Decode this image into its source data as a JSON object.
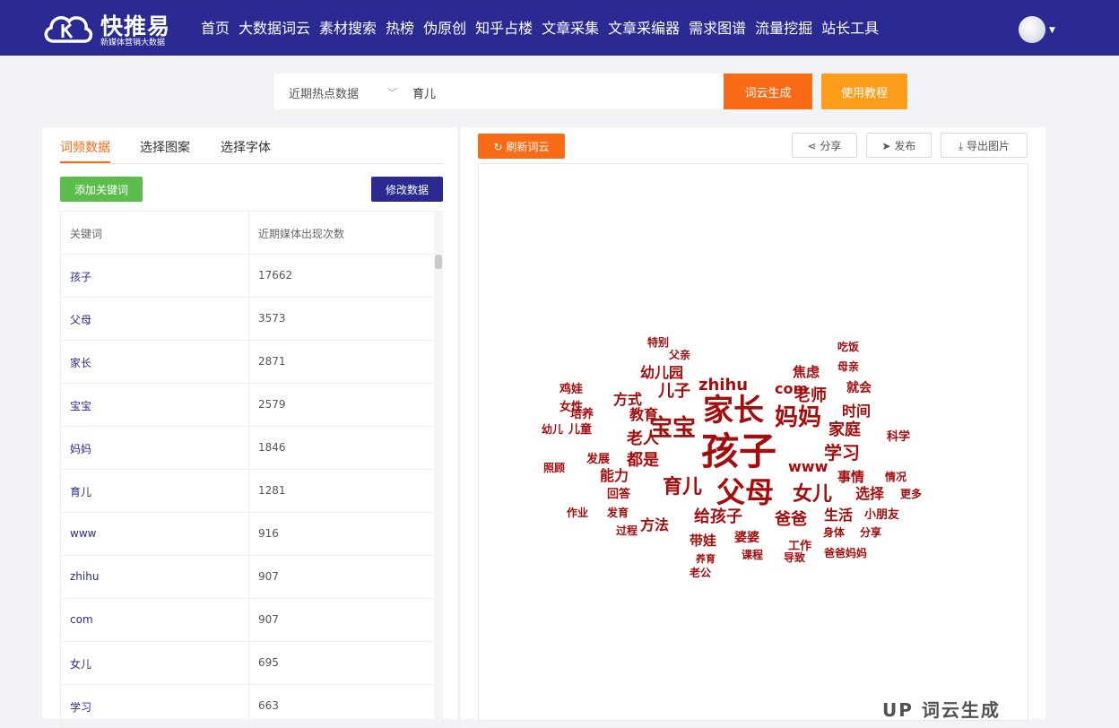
{
  "brand": {
    "name": "快推易",
    "tagline": "新媒体营销大数据"
  },
  "nav": [
    "首页",
    "大数据词云",
    "素材搜索",
    "热榜",
    "伪原创",
    "知乎占楼",
    "文章采集",
    "文章采编器",
    "需求图谱",
    "流量挖掘",
    "站长工具"
  ],
  "search": {
    "source_select": "近期热点数据",
    "query": "育儿",
    "generate_label": "词云生成",
    "tutorial_label": "使用教程"
  },
  "left_tabs": [
    "词频数据",
    "选择图案",
    "选择字体"
  ],
  "left_buttons": {
    "add": "添加关键词",
    "edit": "修改数据"
  },
  "table": {
    "headers": [
      "关键词",
      "近期媒体出现次数"
    ],
    "rows": [
      [
        "孩子",
        "17662"
      ],
      [
        "父母",
        "3573"
      ],
      [
        "家长",
        "2871"
      ],
      [
        "宝宝",
        "2579"
      ],
      [
        "妈妈",
        "1846"
      ],
      [
        "育儿",
        "1281"
      ],
      [
        "www",
        "916"
      ],
      [
        "zhihu",
        "907"
      ],
      [
        "com",
        "907"
      ],
      [
        "女儿",
        "695"
      ],
      [
        "学习",
        "663"
      ]
    ]
  },
  "toolbar": {
    "refresh": "刷新词云",
    "share": "分享",
    "publish": "发布",
    "export": "导出图片"
  },
  "cloud": {
    "color": "#a50d0d",
    "words": [
      {
        "t": "孩子",
        "s": 42
      },
      {
        "t": "家长",
        "s": 34
      },
      {
        "t": "父母",
        "s": 32
      },
      {
        "t": "宝宝",
        "s": 26
      },
      {
        "t": "妈妈",
        "s": 26
      },
      {
        "t": "育儿",
        "s": 22
      },
      {
        "t": "www",
        "s": 16
      },
      {
        "t": "zhihu",
        "s": 18
      },
      {
        "t": "com",
        "s": 16
      },
      {
        "t": "女儿",
        "s": 22
      },
      {
        "t": "学习",
        "s": 20
      },
      {
        "t": "老师",
        "s": 18
      },
      {
        "t": "家庭",
        "s": 18
      },
      {
        "t": "儿子",
        "s": 18
      },
      {
        "t": "教育",
        "s": 16
      },
      {
        "t": "老人",
        "s": 18
      },
      {
        "t": "都是",
        "s": 18
      },
      {
        "t": "时间",
        "s": 16
      },
      {
        "t": "给孩子",
        "s": 18
      },
      {
        "t": "爸爸",
        "s": 18
      },
      {
        "t": "生活",
        "s": 16
      },
      {
        "t": "选择",
        "s": 16
      },
      {
        "t": "方式",
        "s": 16
      },
      {
        "t": "能力",
        "s": 16
      },
      {
        "t": "幼儿园",
        "s": 16
      },
      {
        "t": "焦虑",
        "s": 15
      },
      {
        "t": "就会",
        "s": 14
      },
      {
        "t": "事情",
        "s": 15
      },
      {
        "t": "科学",
        "s": 13
      },
      {
        "t": "方法",
        "s": 16
      },
      {
        "t": "带娃",
        "s": 15
      },
      {
        "t": "婆婆",
        "s": 14
      },
      {
        "t": "小朋友",
        "s": 13
      },
      {
        "t": "身体",
        "s": 12
      },
      {
        "t": "分享",
        "s": 12
      },
      {
        "t": "工作",
        "s": 13
      },
      {
        "t": "课程",
        "s": 12
      },
      {
        "t": "导致",
        "s": 12
      },
      {
        "t": "爸爸妈妈",
        "s": 12
      },
      {
        "t": "情况",
        "s": 12
      },
      {
        "t": "更多",
        "s": 12
      },
      {
        "t": "发展",
        "s": 13
      },
      {
        "t": "回答",
        "s": 13
      },
      {
        "t": "作业",
        "s": 12
      },
      {
        "t": "发育",
        "s": 12
      },
      {
        "t": "过程",
        "s": 12
      },
      {
        "t": "照顾",
        "s": 12
      },
      {
        "t": "儿童",
        "s": 13
      },
      {
        "t": "培养",
        "s": 13
      },
      {
        "t": "女性",
        "s": 13
      },
      {
        "t": "鸡娃",
        "s": 13
      },
      {
        "t": "幼儿",
        "s": 12
      },
      {
        "t": "特别",
        "s": 12
      },
      {
        "t": "父亲",
        "s": 12
      },
      {
        "t": "母亲",
        "s": 12
      },
      {
        "t": "吃饭",
        "s": 12
      },
      {
        "t": "老公",
        "s": 12
      },
      {
        "t": "养育",
        "s": 11
      }
    ]
  },
  "watermark": "UP 词云生成"
}
